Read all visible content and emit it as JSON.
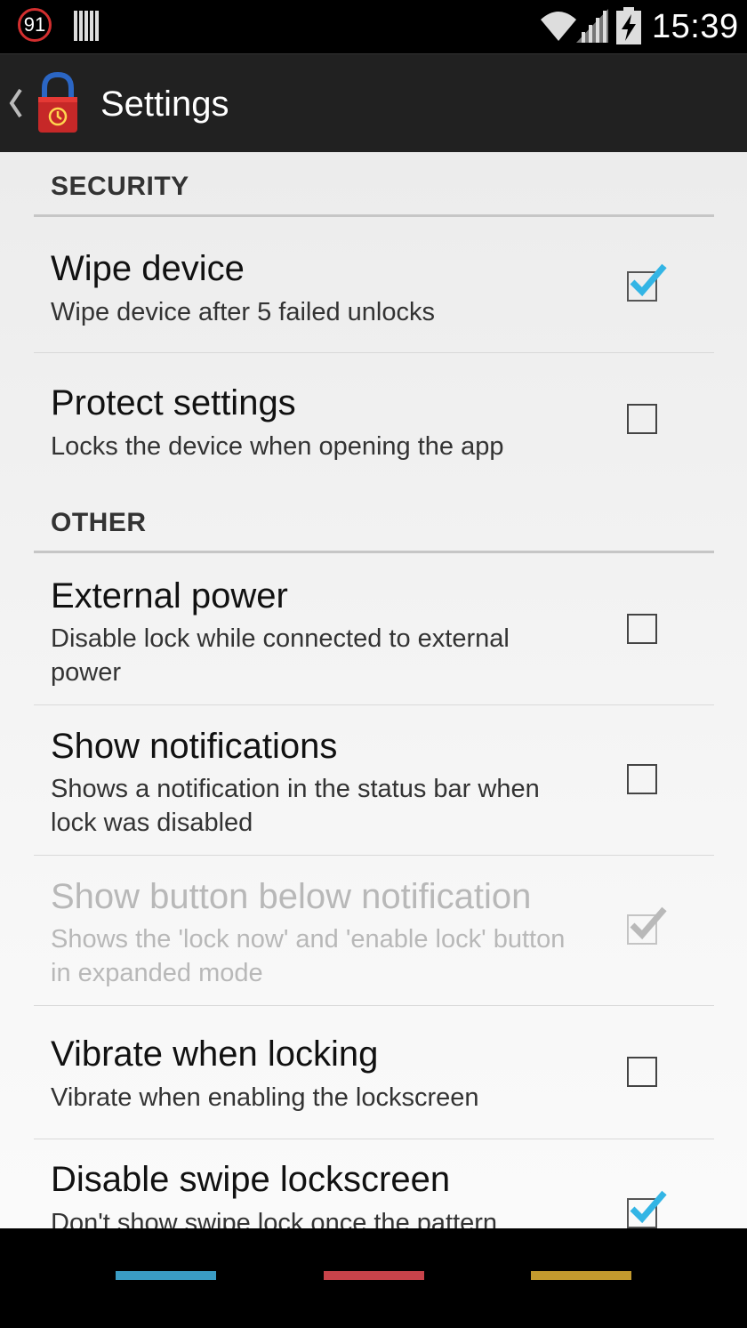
{
  "status_bar": {
    "notification_count": "91",
    "time": "15:39"
  },
  "action_bar": {
    "title": "Settings",
    "icon": "padlock-clock-icon"
  },
  "categories": {
    "security": "SECURITY",
    "other": "OTHER"
  },
  "preferences": {
    "wipe_device": {
      "title": "Wipe device",
      "summary": "Wipe device after 5 failed unlocks",
      "checked": true
    },
    "protect_settings": {
      "title": "Protect settings",
      "summary": "Locks the device when opening the app",
      "checked": false
    },
    "external_power": {
      "title": "External power",
      "summary": "Disable lock while connected to external power",
      "checked": false
    },
    "show_notifications": {
      "title": "Show notifications",
      "summary": "Shows a notification in the status bar when lock was disabled",
      "checked": false
    },
    "show_button": {
      "title": "Show button below notification",
      "summary": "Shows the 'lock now' and 'enable lock' button in expanded mode",
      "checked": true,
      "enabled": false
    },
    "vibrate": {
      "title": "Vibrate when locking",
      "summary": "Vibrate when enabling the lockscreen",
      "checked": false
    },
    "disable_swipe": {
      "title": "Disable swipe lockscreen",
      "summary": "Don't show swipe lock once the pattern",
      "checked": true
    }
  },
  "colors": {
    "check_accent": "#33b5e5",
    "nav_back": "#3a9cc4",
    "nav_home": "#c8434a",
    "nav_recent": "#c39a2e"
  }
}
